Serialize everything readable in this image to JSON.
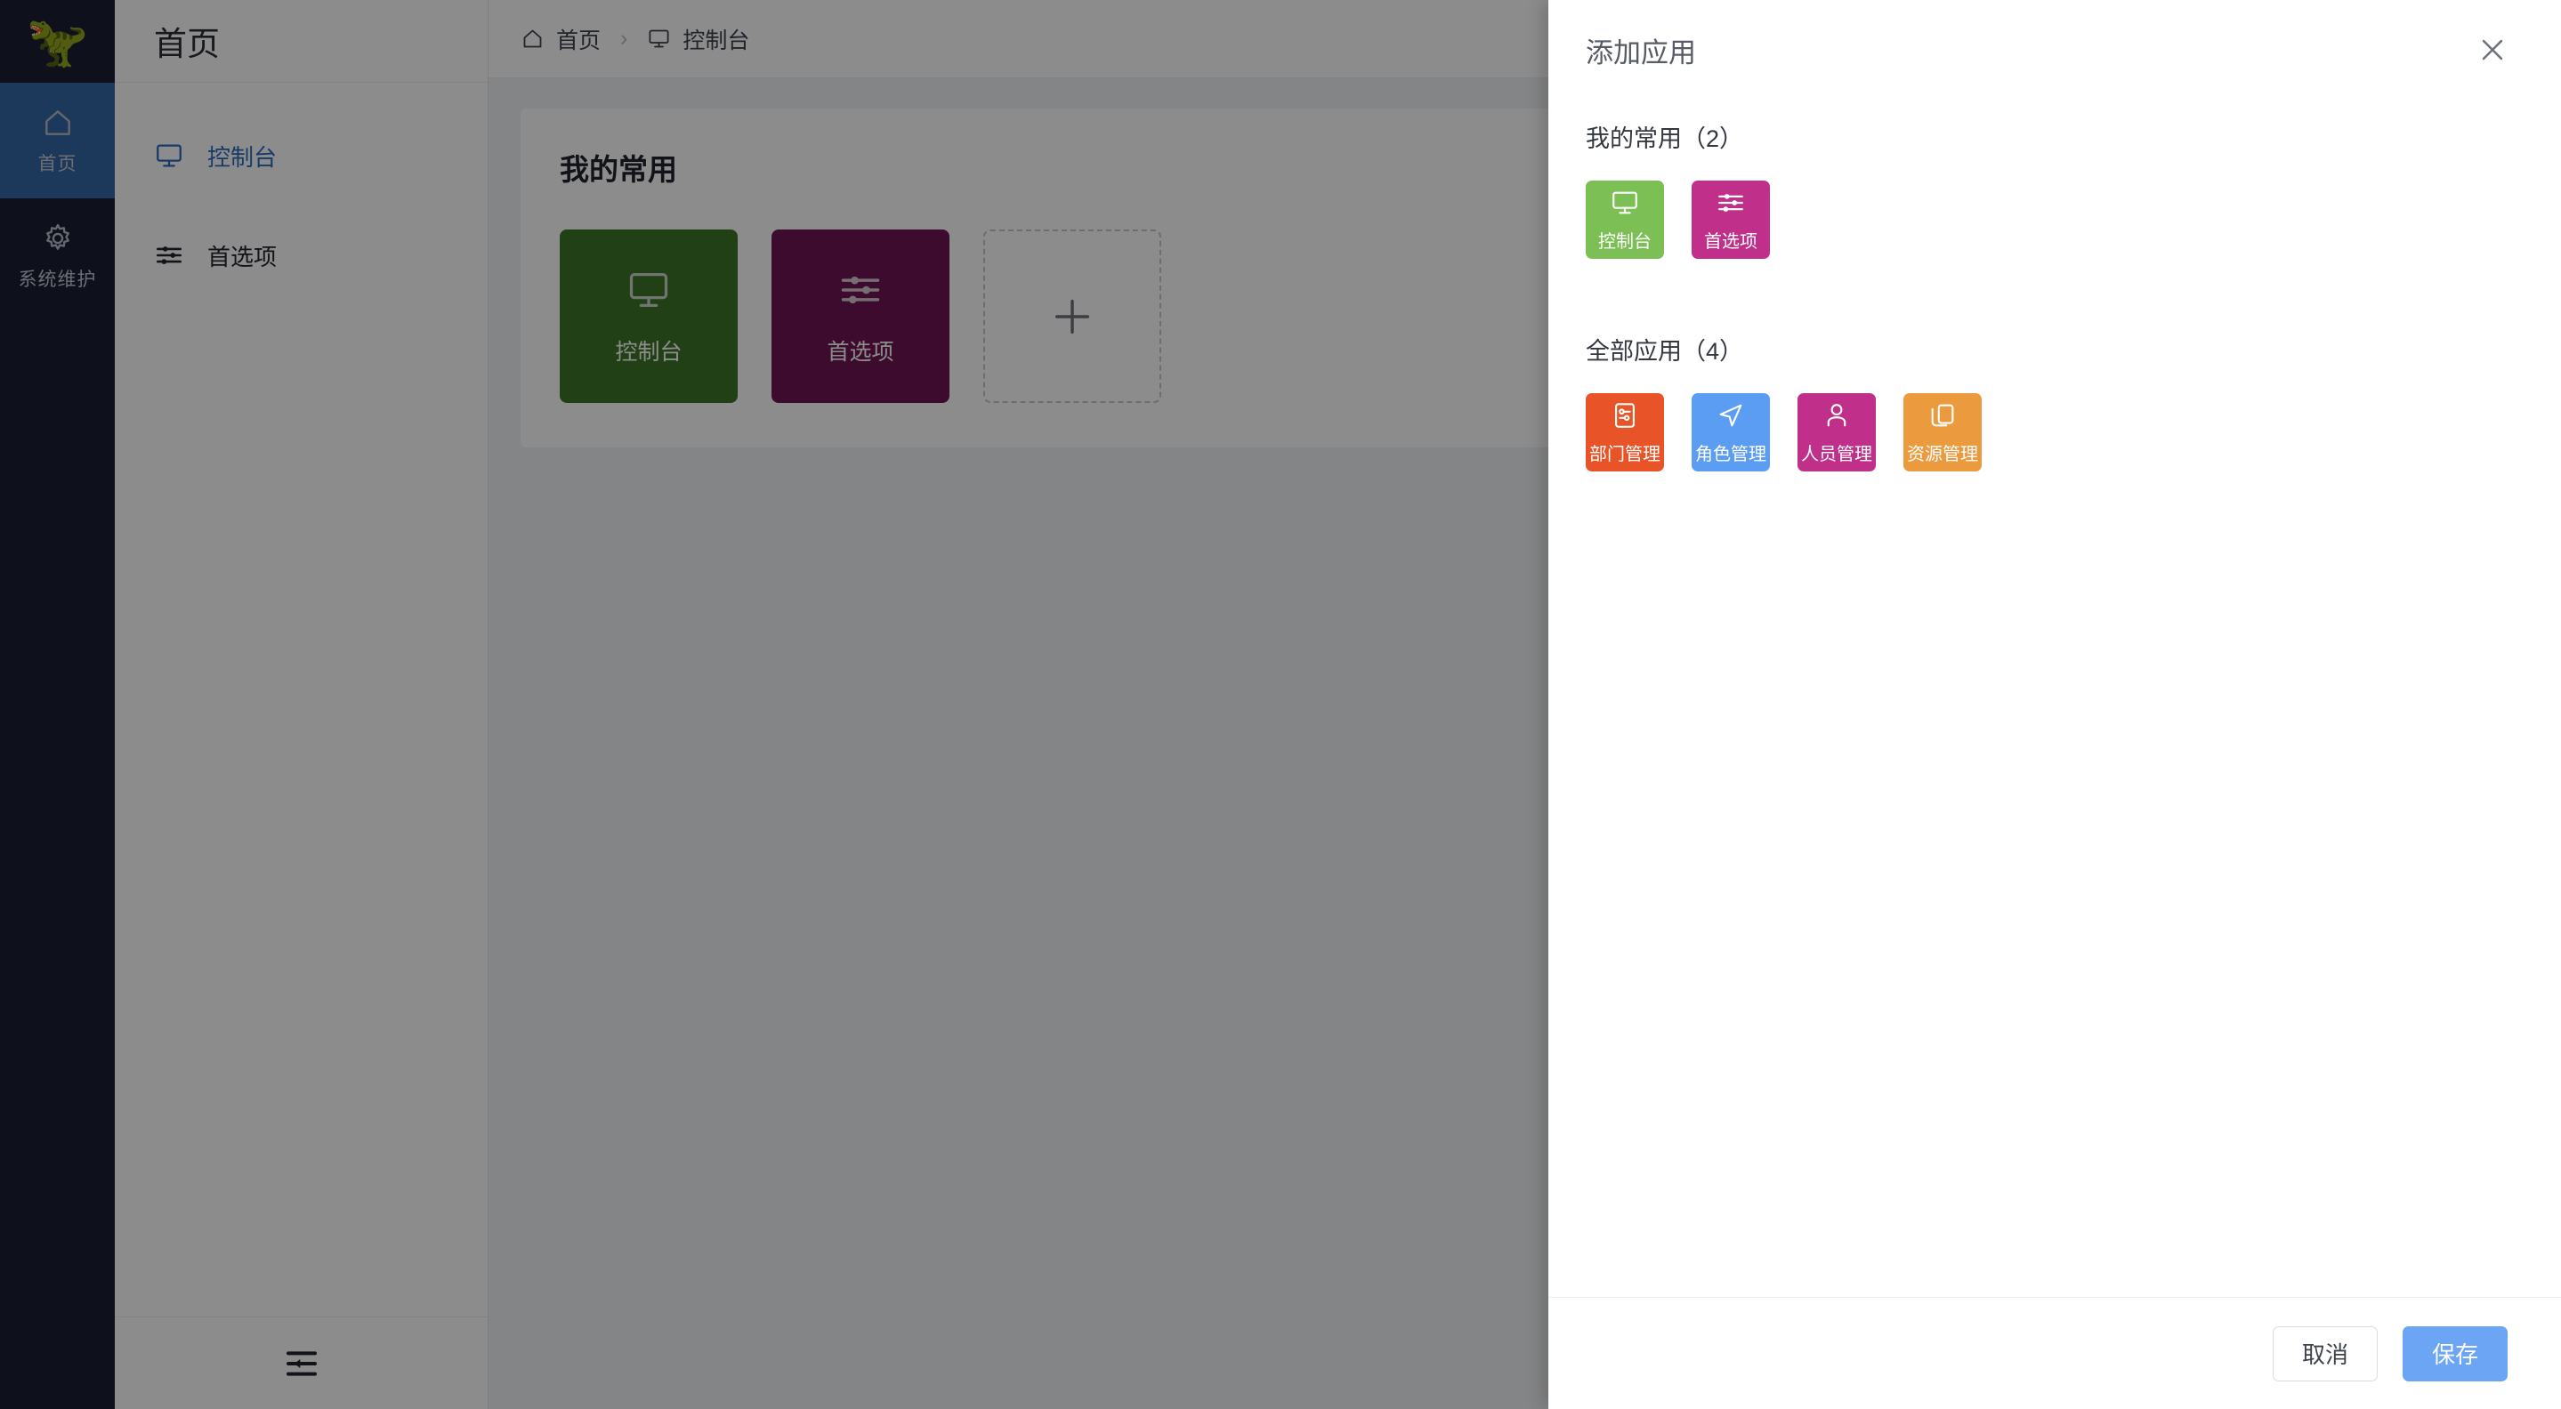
{
  "app": {
    "logo_icon": "t-rex-dinosaur-logo",
    "brand_bg": "#1a1f33"
  },
  "icon_sidebar": {
    "items": [
      {
        "label": "首页",
        "icon": "home-icon",
        "active": true
      },
      {
        "label": "系统维护",
        "icon": "gear-icon",
        "active": false
      }
    ],
    "active_color": "#3367a6"
  },
  "sub_sidebar": {
    "header": "首页",
    "items": [
      {
        "label": "控制台",
        "icon": "monitor-icon",
        "active": true
      },
      {
        "label": "首选项",
        "icon": "sliders-icon",
        "active": false
      }
    ],
    "collapse_icon": "menu-fold-icon",
    "active_color": "#2c6bbd"
  },
  "breadcrumb": {
    "items": [
      {
        "label": "首页",
        "icon": "home-icon"
      },
      {
        "label": "控制台",
        "icon": "monitor-icon"
      }
    ],
    "separator": "›"
  },
  "main_panel": {
    "title": "我的常用",
    "tiles": [
      {
        "label": "控制台",
        "icon": "monitor-icon",
        "color": "#3f7527"
      },
      {
        "label": "首选项",
        "icon": "sliders-icon",
        "color": "#6e1452"
      }
    ],
    "add_tile_icon": "plus-icon"
  },
  "drawer": {
    "title": "添加应用",
    "close_icon": "close-icon",
    "my_favorites": {
      "title": "我的常用（2）",
      "tiles": [
        {
          "label": "控制台",
          "icon": "monitor-icon",
          "color": "#7cbf54"
        },
        {
          "label": "首选项",
          "icon": "sliders-icon",
          "color": "#c0308a"
        }
      ]
    },
    "all_apps": {
      "title": "全部应用（4）",
      "tiles": [
        {
          "label": "部门管理",
          "icon": "form-list-icon",
          "color": "#e85427"
        },
        {
          "label": "角色管理",
          "icon": "navigation-arrow-icon",
          "color": "#5b9df3"
        },
        {
          "label": "人员管理",
          "icon": "person-icon",
          "color": "#c0308a"
        },
        {
          "label": "资源管理",
          "icon": "copy-layers-icon",
          "color": "#ec9a3e"
        }
      ]
    },
    "footer": {
      "cancel_label": "取消",
      "save_label": "保存",
      "save_color": "#6ba5f3"
    }
  }
}
